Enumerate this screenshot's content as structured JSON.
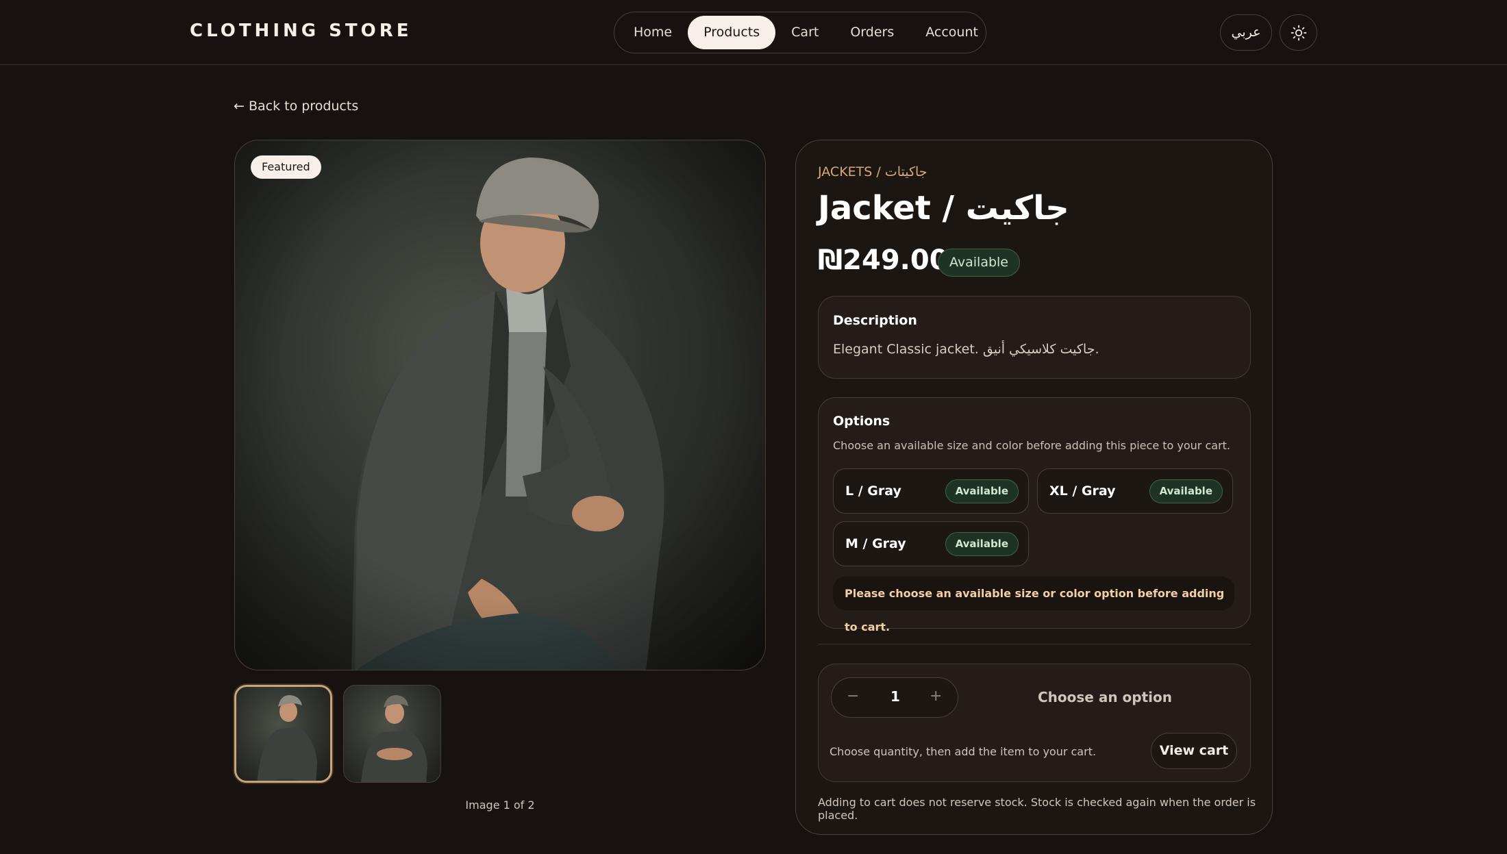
{
  "header": {
    "brand": "CLOTHING STORE",
    "nav": [
      {
        "label": "Home",
        "active": false
      },
      {
        "label": "Products",
        "active": true
      },
      {
        "label": "Cart",
        "active": false
      },
      {
        "label": "Orders",
        "active": false
      },
      {
        "label": "Account",
        "active": false
      }
    ],
    "language_button": "عربي",
    "theme_icon": "sun-icon"
  },
  "back_link": "← Back to products",
  "gallery": {
    "featured_badge": "Featured",
    "counter": "Image 1 of 2",
    "thumbnails": [
      {
        "selected": true
      },
      {
        "selected": false
      }
    ]
  },
  "product": {
    "category": "JACKETS / جاكيتات",
    "title": "Jacket / جاكيت",
    "price": "₪249.00",
    "availability": "Available",
    "description": {
      "heading": "Description",
      "text": "Elegant Classic jacket. جاكيت كلاسيكي أنيق."
    },
    "options": {
      "heading": "Options",
      "subtitle": "Choose an available size and color before adding this piece to your cart.",
      "variants": [
        {
          "label": "L / Gray",
          "status": "Available"
        },
        {
          "label": "XL / Gray",
          "status": "Available"
        },
        {
          "label": "M / Gray",
          "status": "Available"
        }
      ],
      "warning": "Please choose an available size or color option before adding to cart."
    },
    "purchase": {
      "quantity": "1",
      "minus": "−",
      "plus": "+",
      "choose_label": "Choose an option",
      "hint": "Choose quantity, then add the item to your cart.",
      "view_cart": "View cart"
    },
    "stock_note": "Adding to cart does not reserve stock. Stock is checked again when the order is placed."
  },
  "colors": {
    "accent": "#d8a978",
    "available_bg": "#1f3324",
    "available_text": "#cfe8d0",
    "background": "#171210"
  }
}
